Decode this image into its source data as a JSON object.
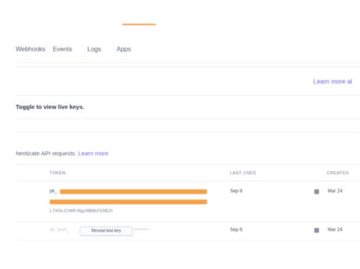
{
  "nav": {
    "items": [
      "Webhooks",
      "Events",
      "Logs",
      "Apps"
    ]
  },
  "banner": {
    "link": "Learn more al"
  },
  "toggle_text": "Toggle to view live keys.",
  "auth": {
    "prefix": "henticate API requests.",
    "link": "Learn more"
  },
  "table": {
    "headers": [
      "TOKEN",
      "LAST USED",
      "CREATED"
    ],
    "rows": [
      {
        "token_prefix": "pk_",
        "token_tail": "L7XGcZ1WFrNgz9B8b2V0lE2l",
        "last_used": "Sep 6",
        "created": "Mar 24"
      },
      {
        "token_masked_prefix": "sk_test_",
        "reveal_label": "Reveal test key",
        "token_masked_suffix": "••••••••",
        "last_used": "Sep 6",
        "created": "Mar 24"
      }
    ]
  },
  "colors": {
    "accent": "#6b63d8",
    "redaction": "#f29a3b",
    "top_accent": "#f5a05a"
  },
  "icons": {
    "copy": "copy-icon"
  }
}
